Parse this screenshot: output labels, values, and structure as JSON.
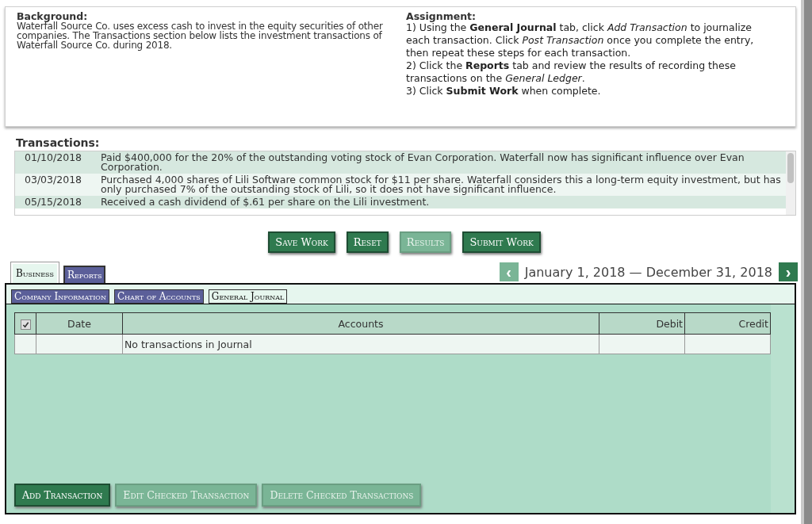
{
  "background": {
    "title": "Background:",
    "text": "Waterfall Source Co. uses excess cash to invest in the equity securities of other companies. The Transactions section below lists the investment transactions of Waterfall Source Co. during 2018."
  },
  "assignment": {
    "title": "Assignment:",
    "lines": [
      "1) Using the **General Journal** tab, click *Add Transaction* to journalize each transaction. Click *Post Transaction* once you complete the entry, then repeat these steps for each transaction.",
      "2) Click the **Reports** tab and review the results of recording these transactions on the *General Ledger*.",
      "3) Click **Submit Work** when complete."
    ]
  },
  "transactions": {
    "title": "Transactions:",
    "rows": [
      {
        "date": "01/10/2018",
        "text": "Paid $400,000 for the 20% of the outstanding voting stock of Evan Corporation. Waterfall now has significant influence over Evan Corporation."
      },
      {
        "date": "03/03/2018",
        "text": "Purchased 4,000 shares of Lili Software common stock for $11 per share. Waterfall considers this a long-term equity investment, but has only purchased 7% of the outstanding stock of Lili, so it does not have significant influence."
      },
      {
        "date": "05/15/2018",
        "text": "Received a cash dividend of $.61 per share on the Lili investment."
      }
    ]
  },
  "actions": [
    {
      "label": "Save Work",
      "disabled": false
    },
    {
      "label": "Reset",
      "disabled": false
    },
    {
      "label": "Results",
      "disabled": true
    },
    {
      "label": "Submit Work",
      "disabled": false
    }
  ],
  "tabs": [
    {
      "label": "Business",
      "selected": true
    },
    {
      "label": "Reports",
      "selected": false
    }
  ],
  "period": {
    "prev": "‹",
    "label": "January 1, 2018 — December 31, 2018",
    "next": "›"
  },
  "subtabs": [
    {
      "label": "Company Information",
      "selected": false
    },
    {
      "label": "Chart of Accounts",
      "selected": false
    },
    {
      "label": "General Journal",
      "selected": true
    }
  ],
  "journal": {
    "all_checked": true,
    "columns": [
      "Date",
      "Accounts",
      "Debit",
      "Credit"
    ],
    "empty_text": "No transactions in Journal"
  },
  "journal_buttons": [
    {
      "label": "Add Transaction",
      "disabled": false
    },
    {
      "label": "Edit Checked Transaction",
      "disabled": true
    },
    {
      "label": "Delete Checked Transactions",
      "disabled": true
    }
  ]
}
